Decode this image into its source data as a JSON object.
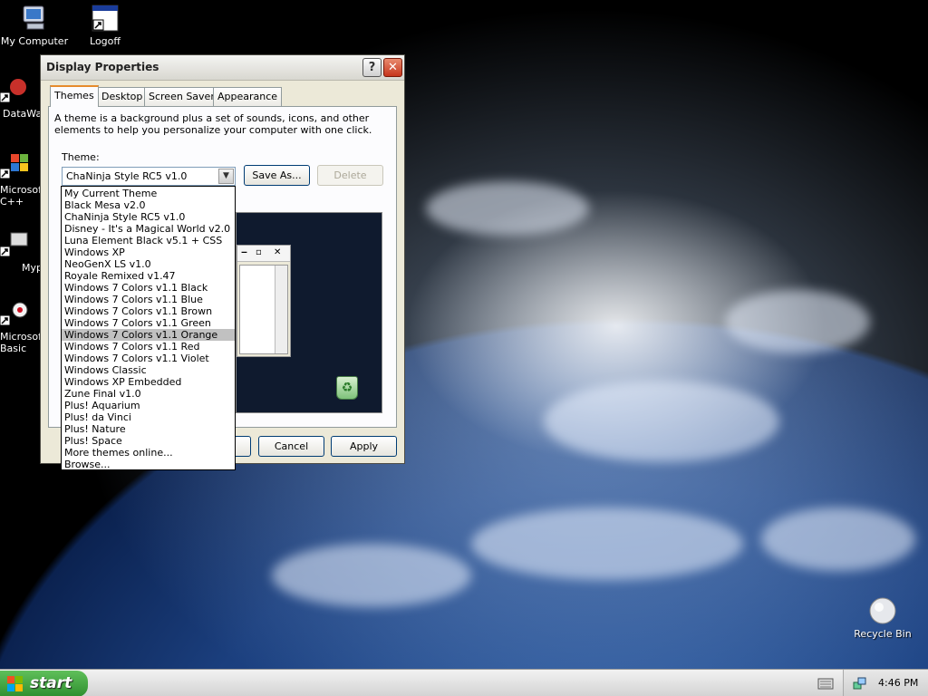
{
  "desktop": {
    "icons": [
      {
        "id": "my-computer",
        "label": "My Computer"
      },
      {
        "id": "logoff",
        "label": "Logoff"
      },
      {
        "id": "datawatch",
        "label": "DataWat"
      },
      {
        "id": "ms-cpp",
        "label": "Microsoft C++"
      },
      {
        "id": "mypro",
        "label": "Myp"
      },
      {
        "id": "ms-basic",
        "label": "Microsoft Basic"
      },
      {
        "id": "recycle-bin",
        "label": "Recycle Bin"
      }
    ]
  },
  "window": {
    "title": "Display Properties",
    "help_label": "?",
    "close_label": "✕",
    "tabs": [
      {
        "label": "Themes",
        "active": true
      },
      {
        "label": "Desktop",
        "active": false
      },
      {
        "label": "Screen Saver",
        "active": false
      },
      {
        "label": "Appearance",
        "active": false
      }
    ],
    "description": "A theme is a background plus a set of sounds, icons, and other elements to help you personalize your computer with one click.",
    "theme_label": "Theme:",
    "theme_value": "ChaNinja Style RC5 v1.0",
    "save_as_label": "Save As...",
    "delete_label": "Delete",
    "cancel_label": "Cancel",
    "apply_label": "Apply",
    "theme_options": [
      "My Current Theme",
      "Black Mesa v2.0",
      "ChaNinja Style RC5 v1.0",
      "Disney - It's a Magical World v2.0",
      "Luna Element Black v5.1 + CSS",
      "Windows XP",
      "NeoGenX LS v1.0",
      "Royale Remixed v1.47",
      "Windows 7 Colors v1.1 Black",
      "Windows 7 Colors v1.1 Blue",
      "Windows 7 Colors v1.1 Brown",
      "Windows 7 Colors v1.1 Green",
      "Windows 7 Colors v1.1 Orange",
      "Windows 7 Colors v1.1 Red",
      "Windows 7 Colors v1.1 Violet",
      "Windows Classic",
      "Windows XP Embedded",
      "Zune Final v1.0",
      "Plus! Aquarium",
      "Plus! da Vinci",
      "Plus! Nature",
      "Plus! Space",
      "More themes online...",
      "Browse..."
    ],
    "highlighted_option": "Windows 7 Colors v1.1 Orange"
  },
  "taskbar": {
    "start_label": "start",
    "clock": "4:46 PM"
  },
  "colors": {
    "accent_tab": "#e68b2c",
    "start_green": "#3a9a3a",
    "highlight": "#c1c1c1"
  }
}
